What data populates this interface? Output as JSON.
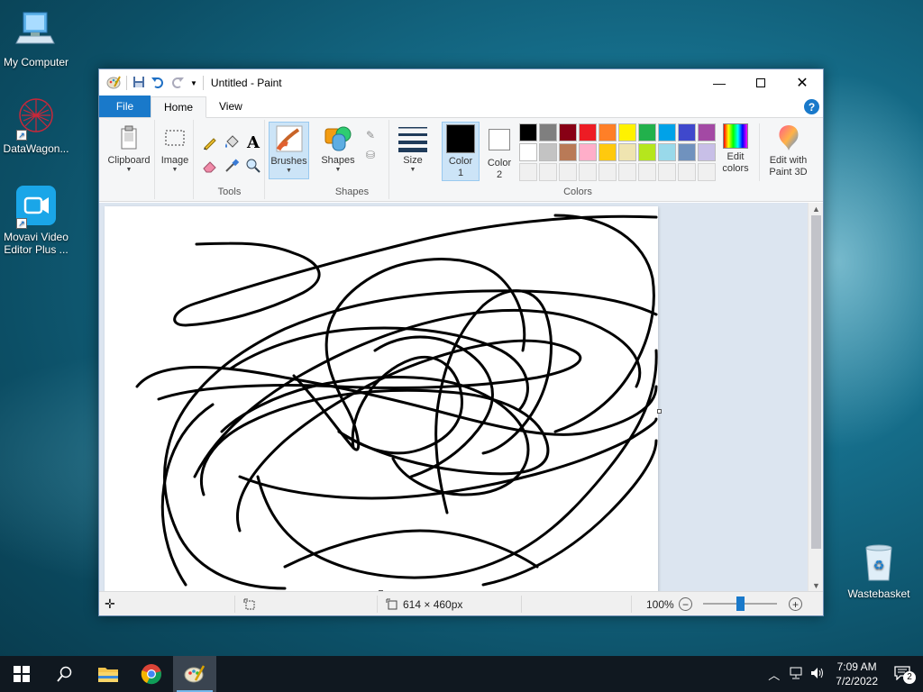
{
  "desktop": {
    "icons": [
      {
        "label": "My Computer"
      },
      {
        "label": "DataWagon..."
      },
      {
        "label": "Movavi Video Editor Plus ..."
      },
      {
        "label": "Wastebasket"
      }
    ]
  },
  "window": {
    "title": "Untitled - Paint",
    "tabs": {
      "file": "File",
      "home": "Home",
      "view": "View"
    },
    "help": "?",
    "ribbon": {
      "clipboard": "Clipboard",
      "image": "Image",
      "tools_label": "Tools",
      "brushes": "Brushes",
      "shapes_btn": "Shapes",
      "shapes_label": "Shapes",
      "size": "Size",
      "color1": "Color 1",
      "color2": "Color 2",
      "colors_label": "Colors",
      "edit_colors": "Edit colors",
      "edit_with_paint3d": "Edit with Paint 3D",
      "palette_row1": [
        "#000000",
        "#7f7f7f",
        "#880015",
        "#ed1c24",
        "#ff7f27",
        "#fff200",
        "#22b14c",
        "#00a2e8",
        "#3f48cc",
        "#a349a4"
      ],
      "palette_row2": [
        "#ffffff",
        "#c3c3c3",
        "#b97a57",
        "#ffaec9",
        "#ffc90e",
        "#efe4b0",
        "#b5e61d",
        "#99d9ea",
        "#7092be",
        "#c8bfe7"
      ],
      "color1_value": "#000000",
      "color2_value": "#ffffff"
    },
    "status": {
      "image_size": "614 × 460px",
      "zoom": "100%"
    }
  },
  "taskbar": {
    "time": "7:09 AM",
    "date": "7/2/2022",
    "notifications": "2"
  }
}
